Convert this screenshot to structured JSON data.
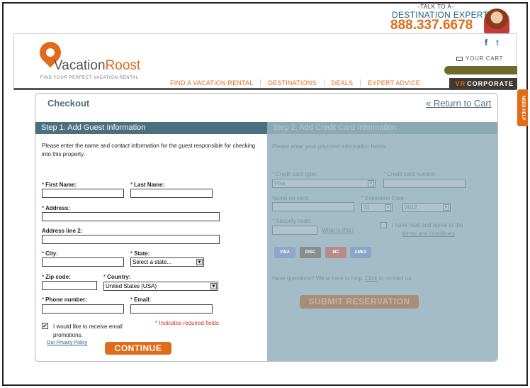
{
  "promo": {
    "talk_to": "-TALK TO A-",
    "expert": "DESTINATION EXPERT",
    "phone": "888.337.6678"
  },
  "header": {
    "logo_main": "Vacation",
    "logo_accent": "Roost",
    "tagline": "FIND YOUR PERFECT VACATION RENTAL",
    "nav": [
      "FIND A VACATION RENTAL",
      "DESTINATIONS",
      "DEALS",
      "EXPERT ADVICE"
    ],
    "social": {
      "facebook": "f",
      "twitter": "t"
    },
    "cart_label": "YOUR CART",
    "corporate_prefix": "VR",
    "corporate_label": "CORPORATE"
  },
  "side_tab": "NEED HELP",
  "checkout": {
    "title": "Checkout",
    "return_link": "« Return to Cart"
  },
  "step1": {
    "title": "Step 1. Add Guest Information",
    "intro": "Please enter the name and contact information for the guest responsible for checking into this property.",
    "required_mark": "*",
    "first_name_label": "First Name:",
    "last_name_label": "Last Name:",
    "address_label": "Address:",
    "address2_label": "Address line 2:",
    "city_label": "City:",
    "state_label": "State:",
    "state_value": "Select a state...",
    "zip_label": "Zip code:",
    "country_label": "Country:",
    "country_value": "United States (USA)",
    "phone_label": "Phone number:",
    "email_label": "Email:",
    "promo_checkbox": "✔",
    "promo_text": "I would like to receive email promotions.",
    "privacy_link": "Our Privacy Policy",
    "required_note": "* Indicates required fields",
    "continue_label": "CONTINUE"
  },
  "step2": {
    "title": "Step 2. Add Credit Card Information",
    "intro": "Please enter your payment information below",
    "card_type_label": "Credit card type:",
    "card_type_value": "Visa",
    "card_number_label": "Credit card number:",
    "name_on_card_label": "Name on card:",
    "expiration_label": "Expiration Date:",
    "exp_month": "01",
    "exp_year": "2012",
    "security_label": "Security code:",
    "what_is_this": "What is this?",
    "agree_text": "I have read and agree to the",
    "terms_link": "terms and conditions",
    "cards": [
      "VISA",
      "DISC",
      "MC",
      "AMEX"
    ],
    "help_text": "Have questions? We're here to help.",
    "click_link": "Click",
    "contact_text": "to contact us.",
    "submit_label": "SUBMIT RESERVATION"
  },
  "colors": {
    "accent": "#e06b1a",
    "brand_blue": "#4c6f80",
    "disabled_panel": "#a4bcc8"
  }
}
